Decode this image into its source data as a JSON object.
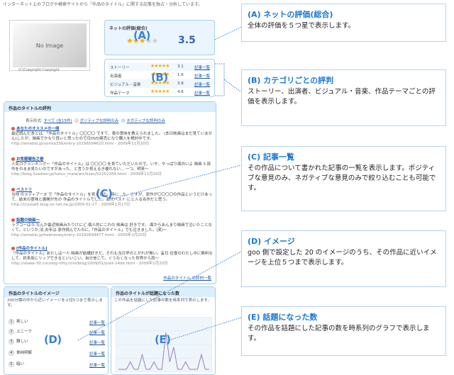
{
  "intro_text": "インターネット上のブログや検索サイトから「作品のタイトル」に関する記事を独占・分析しています。",
  "noimage": {
    "label": "No Image",
    "copyright": "(C)Copyright Copyright"
  },
  "rating": {
    "title": "ネットの評価(総合)",
    "stars": 3.5,
    "score": "3.5",
    "marker": "(A)"
  },
  "categories": {
    "marker": "(B)",
    "rows": [
      {
        "label": "ストーリー",
        "score": "3.1",
        "link": "記事一覧"
      },
      {
        "label": "出演者",
        "score": "1.6",
        "link": "記事一覧"
      },
      {
        "label": "ビジュアル・音楽",
        "score": "3.8",
        "link": "記事一覧"
      },
      {
        "label": "作品テーマ",
        "score": "4.6",
        "link": "記事一覧"
      }
    ]
  },
  "articles": {
    "heading": "作品のタイトルの評判",
    "filter_label": "表示形式:",
    "filter_all": "すべて (全15件)",
    "filter_positive": "ポジティブな評判のみ",
    "filter_negative": "ネガティブな評判のみ",
    "marker": "(C)",
    "items": [
      {
        "title": "あなたのオススメの一冊",
        "snippet": "最近読んだ本とは、「作品のタイトル」〇〇〇〇 ですて、東の意味を教えられました。 (本日映画はまだ見ていません)したが、映画でかなり良いと思ったので日DVD発売になり購入を検討中です。",
        "url": "http://ameblo.jp/yomia336/entry-10196594620.html - 2009年11月20日"
      },
      {
        "title": "お気軽報告之巻",
        "snippet": "人気ログランキング〜「作品のタイトル」は 〇〇〇〇 を見ていただいたので。いや、やっぱり面白いよ 映画 3 部作をのまま見たいのですがあった、と言うか見えるき優れない... 一つ、明来〜",
        "url": "http://blog.livedoor.jp/hatsu_mare/archives/52252269.html - 2009年11月20日"
      },
      {
        "title": "ベストリ",
        "snippet": "当地 のメディアーヌ で「作品のタイトル」を見ました。時に…た。さすが、原作が〇〇〇〇の作品というだけあって、結末の意味と展開が先の 作品のタイトルでした。面代ベスト にと入る名作だと思う。",
        "url": "http://crystal5.blog.so-net.ne.jp/2009-01-17 - 2009年1月17日"
      },
      {
        "title": "話題の映画〜",
        "snippet": "ラブコーは今,なんか最近映画みたりけにど,個人的にこれの 映画は 好きです。 面からあんまり映画で泣いたことなくて。というか,法,去年は 原作読んでたのに,「作品のタイトル」でも泣きました。(笑)〜",
        "url": "http://ameblo.jp/hebhoney/entry-10192694477.html - 2009年1月20日"
      },
      {
        "title": "[作品のタイトル]",
        "snippet": "「作品のタイトル」あたしは一人 映画が結構好きだ。それも当日早のとがれが無い。妄日 往復のわたし中に無料なして、到来用にリップできるといいこい。自分信じて。ぐうなくなった世界から雨〜",
        "url": "http://shake-30.cocolog-nifty.com/blog/2009/01/post-14de.html - 2009年1月20日"
      }
    ],
    "more_link": "作品のタイトル の評判一覧"
  },
  "images": {
    "heading": "作品のタイトルのイメージ",
    "description": "200分類の中から近いイメージを上位5つまで表示します。",
    "marker": "(D)",
    "rows": [
      {
        "num": "1",
        "label": "楽しい",
        "link": "記事一覧"
      },
      {
        "num": "2",
        "label": "ユニーク",
        "link": "記事一覧"
      },
      {
        "num": "3",
        "label": "難しい",
        "link": "記事一覧"
      },
      {
        "num": "4",
        "label": "単純明解",
        "link": "記事一覧"
      },
      {
        "num": "5",
        "label": "暗い",
        "link": "記事一覧"
      }
    ]
  },
  "topic": {
    "heading": "作品のタイトルが話題になった数",
    "description": "この作品を話題にした記事の数を時系列で表示します。",
    "marker": "(E)",
    "chart_data": {
      "type": "line",
      "values": [
        0,
        0,
        0,
        1,
        0,
        0,
        2,
        0,
        0,
        1,
        0,
        0,
        5,
        1,
        3,
        0,
        0,
        1,
        0,
        0,
        0,
        2,
        0,
        0
      ]
    }
  },
  "callouts": [
    {
      "title": "(A) ネットの評価(総合)",
      "body": "全体の評価を５つ星で表示します。"
    },
    {
      "title": "(B) カテゴリごとの評判",
      "body": "ストーリー、出演者、ビジュアル・音楽、作品テーマごとの評価を表示します。"
    },
    {
      "title": "(C) 記事一覧",
      "body": "その作品について書かれた記事の一覧を表示します。ポジティブな意見のみ、ネガティブな意見のみで絞り込むことも可能です。"
    },
    {
      "title": "(D) イメージ",
      "body": "goo 側で設定した 20 のイメージのうち、その作品に近いイメージを上位５つまで表示します。"
    },
    {
      "title": "(E) 話題になった数",
      "body": "その作品を話題にした記事の数を時系列のグラフで表示します。"
    }
  ],
  "colors": {
    "accent": "#1d78d0",
    "border": "#a8cfe8",
    "link": "#1a55a8",
    "star": "#f0b000"
  }
}
